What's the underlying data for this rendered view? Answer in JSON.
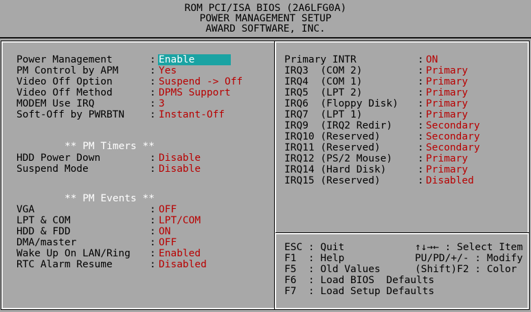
{
  "header": {
    "line1": "ROM PCI/ISA BIOS (2A6LFG0A)",
    "line2": "POWER MANAGEMENT SETUP",
    "line3": "AWARD SOFTWARE, INC."
  },
  "left": {
    "items": [
      {
        "label": "Power Management",
        "sep": ":",
        "value": "Enable"
      },
      {
        "label": "PM Control by APM",
        "sep": ":",
        "value": "Yes"
      },
      {
        "label": "Video Off Option",
        "sep": ":",
        "value": "Suspend -> Off"
      },
      {
        "label": "Video Off Method",
        "sep": ":",
        "value": "DPMS Support"
      },
      {
        "label": "MODEM Use IRQ",
        "sep": ":",
        "value": "3"
      },
      {
        "label": "Soft-Off by PWRBTN",
        "sep": ":",
        "value": "Instant-Off"
      }
    ],
    "timers_title": "** PM Timers **",
    "timers": [
      {
        "label": "HDD Power Down",
        "sep": ":",
        "value": "Disable"
      },
      {
        "label": "Suspend Mode",
        "sep": ":",
        "value": "Disable"
      }
    ],
    "events_title": "** PM Events **",
    "events": [
      {
        "label": "VGA",
        "sep": ":",
        "value": "OFF"
      },
      {
        "label": "LPT & COM",
        "sep": ":",
        "value": "LPT/COM"
      },
      {
        "label": "HDD & FDD",
        "sep": ":",
        "value": "ON"
      },
      {
        "label": "DMA/master",
        "sep": ":",
        "value": "OFF"
      },
      {
        "label": "Wake Up On LAN/Ring",
        "sep": ":",
        "value": "Enabled"
      },
      {
        "label": "RTC Alarm Resume",
        "sep": ":",
        "value": "Disabled"
      }
    ]
  },
  "right": {
    "items": [
      {
        "label": "Primary INTR",
        "sep": ":",
        "value": "ON"
      },
      {
        "label": "IRQ3  (COM 2)",
        "sep": ":",
        "value": "Primary"
      },
      {
        "label": "IRQ4  (COM 1)",
        "sep": ":",
        "value": "Primary"
      },
      {
        "label": "IRQ5  (LPT 2)",
        "sep": ":",
        "value": "Primary"
      },
      {
        "label": "IRQ6  (Floppy Disk)",
        "sep": ":",
        "value": "Primary"
      },
      {
        "label": "IRQ7  (LPT 1)",
        "sep": ":",
        "value": "Primary"
      },
      {
        "label": "IRQ9  (IRQ2 Redir)",
        "sep": ":",
        "value": "Secondary"
      },
      {
        "label": "IRQ10 (Reserved)",
        "sep": ":",
        "value": "Secondary"
      },
      {
        "label": "IRQ11 (Reserved)",
        "sep": ":",
        "value": "Secondary"
      },
      {
        "label": "IRQ12 (PS/2 Mouse)",
        "sep": ":",
        "value": "Primary"
      },
      {
        "label": "IRQ14 (Hard Disk)",
        "sep": ":",
        "value": "Primary"
      },
      {
        "label": "IRQ15 (Reserved)",
        "sep": ":",
        "value": "Disabled"
      }
    ]
  },
  "help": {
    "esc": "ESC : Quit",
    "f1": "F1  : Help",
    "f5": "F5  : Old Values",
    "f6": "F6  : Load BIOS  Defaults",
    "f7": "F7  : Load Setup Defaults",
    "select": "↑↓→← : Select Item",
    "modify": "PU/PD/+/- : Modify",
    "color": "(Shift)F2 : Color"
  },
  "colors": {
    "background": "#a8a8a8",
    "value": "#b80000",
    "highlight": "#1aa3a3",
    "section_title": "#ffffff"
  }
}
